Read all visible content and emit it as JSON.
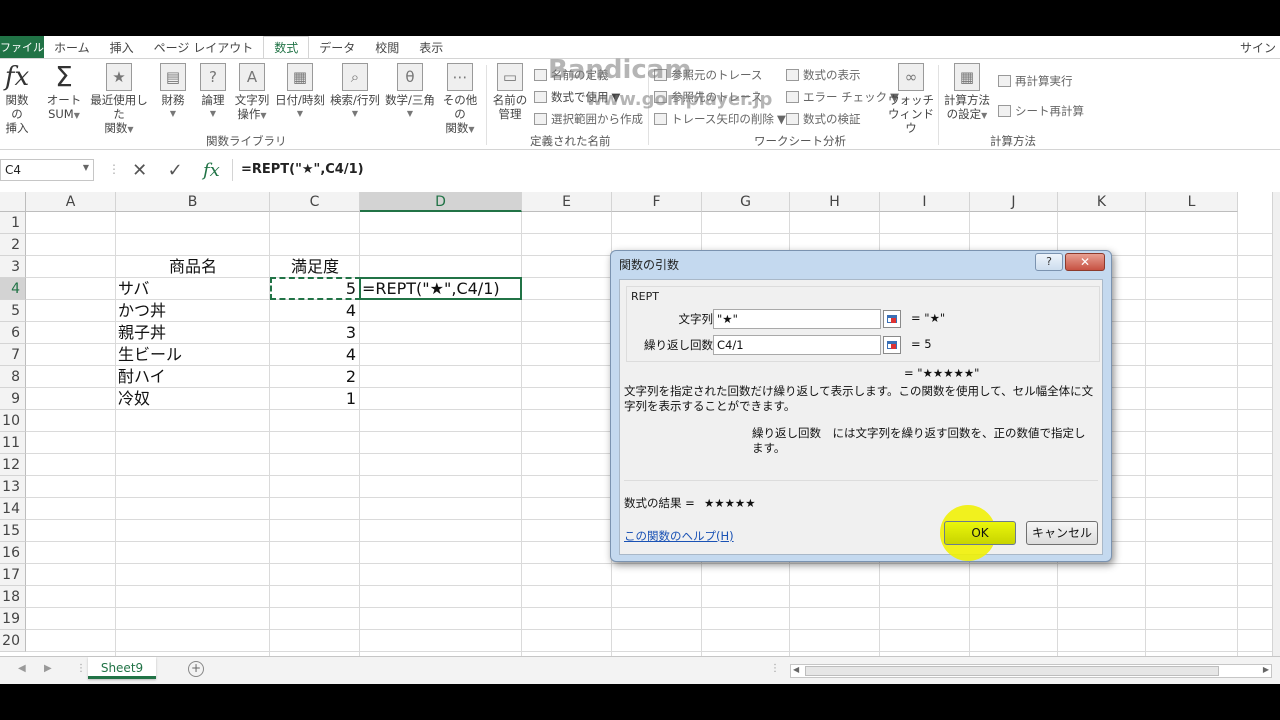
{
  "ribbon_tabs": [
    "ファイル",
    "ホーム",
    "挿入",
    "ページ レイアウト",
    "数式",
    "データ",
    "校閲",
    "表示"
  ],
  "active_tab": "数式",
  "signin": "サイン",
  "ribbon": {
    "insert_function": [
      "関数の",
      "挿入"
    ],
    "autosum": [
      "オート",
      "SUM"
    ],
    "recent": [
      "最近使用した",
      "関数"
    ],
    "financial": "財務",
    "logical": "論理",
    "text": [
      "文字列",
      "操作"
    ],
    "datetime": "日付/時刻",
    "lookup": "検索/行列",
    "math": "数学/三角",
    "more": [
      "その他の",
      "関数"
    ],
    "group_library": "関数ライブラリ",
    "name_manager": [
      "名前の",
      "管理"
    ],
    "define_name": "名前の定義",
    "use_in_formula": "数式で使用",
    "create_from_selection": "選択範囲から作成",
    "group_names": "定義された名前",
    "trace_precedents": "参照元のトレース",
    "trace_dependents": "参照先のトレース",
    "remove_arrows": "トレース矢印の削除",
    "show_formulas": "数式の表示",
    "error_check": "エラー チェック",
    "evaluate": "数式の検証",
    "watch": [
      "ウォッチ",
      "ウィンドウ"
    ],
    "group_audit": "ワークシート分析",
    "calc_options": [
      "計算方法",
      "の設定"
    ],
    "calc_now": "再計算実行",
    "calc_sheet": "シート再計算",
    "group_calc": "計算方法"
  },
  "watermark": {
    "line1": "Bandicam",
    "line2": "www.gomplayer.jp"
  },
  "formula_bar": {
    "name_box": "C4",
    "formula": "=REPT(\"★\",C4/1)"
  },
  "columns": [
    "A",
    "B",
    "C",
    "D",
    "E",
    "F",
    "G",
    "H",
    "I",
    "J",
    "K",
    "L"
  ],
  "rows": [
    "1",
    "2",
    "3",
    "4",
    "5",
    "6",
    "7",
    "8",
    "9",
    "10",
    "11",
    "12",
    "13",
    "14",
    "15",
    "16",
    "17",
    "18",
    "19",
    "20"
  ],
  "table": {
    "header_item": "商品名",
    "header_score": "満足度",
    "rows": [
      {
        "item": "サバ",
        "score": "5"
      },
      {
        "item": "かつ丼",
        "score": "4"
      },
      {
        "item": "親子丼",
        "score": "3"
      },
      {
        "item": "生ビール",
        "score": "4"
      },
      {
        "item": "酎ハイ",
        "score": "2"
      },
      {
        "item": "冷奴",
        "score": "1"
      }
    ],
    "edit_cell": "=REPT(\"★\",C4/1)"
  },
  "sheet_tab": "Sheet9",
  "dialog": {
    "title": "関数の引数",
    "help_btn": "?",
    "close_btn": "✕",
    "function_name": "REPT",
    "arg1_label": "文字列",
    "arg1_value": "\"★\"",
    "arg1_result": "= \"★\"",
    "arg2_label": "繰り返し回数",
    "arg2_value": "C4/1",
    "arg2_result": "= 5",
    "overall_result": "= \"★★★★★\"",
    "description": "文字列を指定された回数だけ繰り返して表示します。この関数を使用して、セル幅全体に文字列を表示することができます。",
    "arg_description": "繰り返し回数　には文字列を繰り返す回数を、正の数値で指定します。",
    "formula_result_label": "数式の結果 =",
    "formula_result_value": "★★★★★",
    "help_link": "この関数のヘルプ(H)",
    "ok": "OK",
    "cancel": "キャンセル"
  }
}
